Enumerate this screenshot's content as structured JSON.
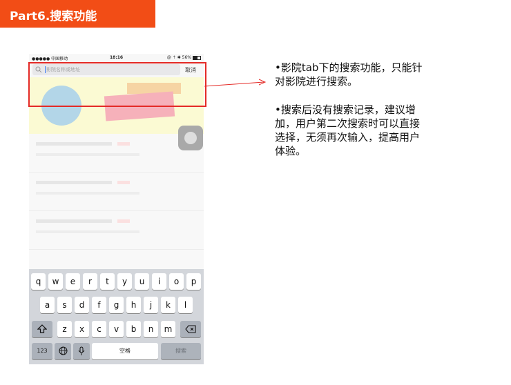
{
  "slide": {
    "title": "Part6.搜索功能",
    "title_bg_color": "#f24d16",
    "annotation_color": "#e42a26",
    "notes": [
      "•影院tab下的搜索功能，只能针对影院进行搜索。",
      "•搜索后没有搜索记录，建议增加，用户第二次搜索时可以直接选择，无须再次输入，提高用户体验。"
    ]
  },
  "phone": {
    "status_bar": {
      "carrier": "●●●●● 中国移动 ",
      "time": "18:16",
      "battery": "@ ⇡ ✱ 56%"
    },
    "search": {
      "placeholder": "影院名称或地址",
      "value": "",
      "cancel_label": "取消",
      "icon": "search-icon"
    },
    "keyboard": {
      "row1": [
        "q",
        "w",
        "e",
        "r",
        "t",
        "y",
        "u",
        "i",
        "o",
        "p"
      ],
      "row2": [
        "a",
        "s",
        "d",
        "f",
        "g",
        "h",
        "j",
        "k",
        "l"
      ],
      "row3": [
        "z",
        "x",
        "c",
        "v",
        "b",
        "n",
        "m"
      ],
      "shift_icon": "shift-icon",
      "delete_icon": "delete-icon",
      "numbers_label": "123",
      "globe_icon": "globe-icon",
      "mic_icon": "microphone-icon",
      "space_label": "空格",
      "search_label": "搜索"
    }
  }
}
